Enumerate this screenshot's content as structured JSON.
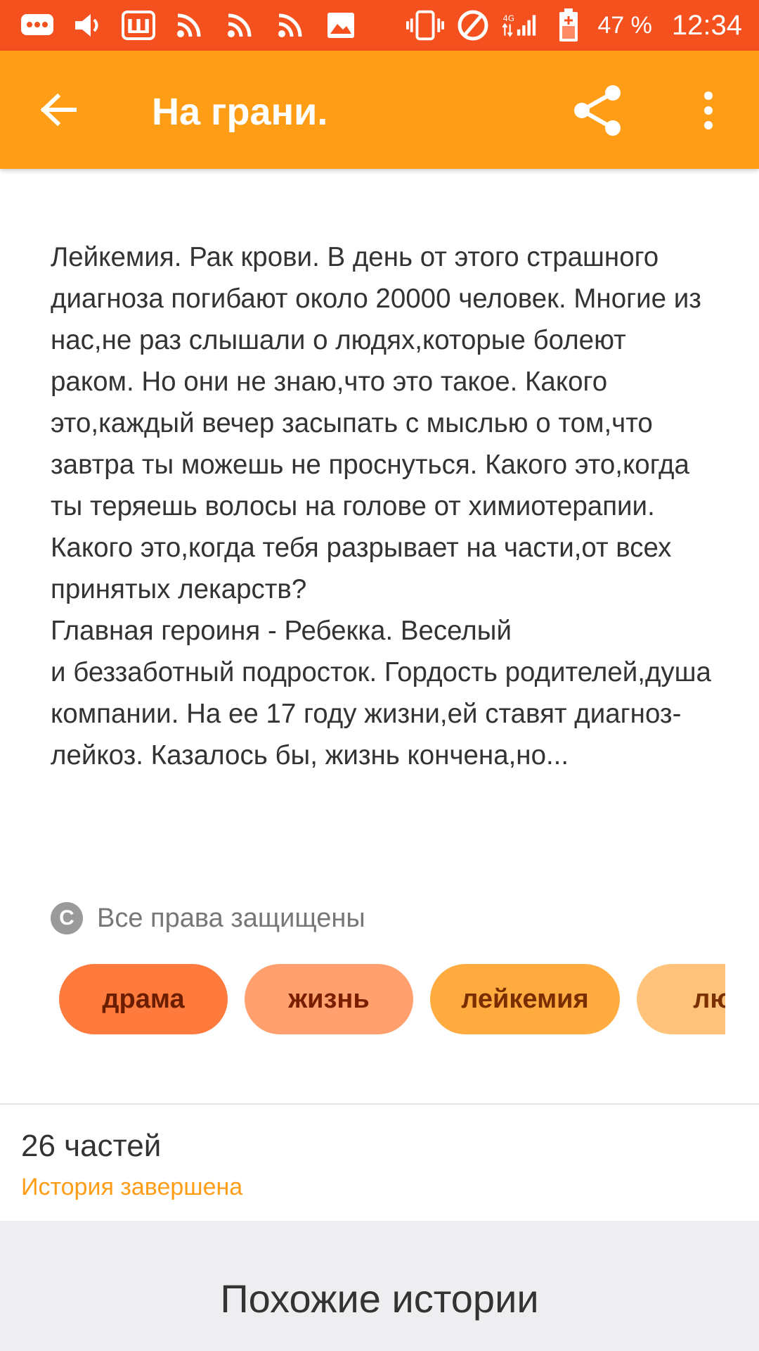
{
  "status_bar": {
    "battery_text": "47 %",
    "time": "12:34",
    "network": "4G",
    "icons": [
      "messages-icon",
      "volume-icon",
      "app-icon-sh",
      "rss-icon",
      "rss-icon",
      "rss-icon",
      "image-icon",
      "vibrate-icon",
      "do-not-disturb-icon",
      "signal-icon",
      "battery-icon"
    ],
    "color": "#f4511e"
  },
  "app_bar": {
    "title": "На грани.",
    "color": "#ff9d17",
    "back_icon": "arrow-left-icon",
    "share_icon": "share-icon",
    "more_icon": "more-vert-icon"
  },
  "description": {
    "paragraph1": "Лейкемия. Рак крови. В день от этого страшного диагноза погибают около 20000 человек. Многие из нас,не раз слышали о людях,которые болеют раком. Но они не знаю,что это такое. Какого это,каждый вечер засыпать с мыслью о том,что завтра ты можешь не проснуться. Какого это,когда ты теряешь волосы на голове от химиотерапии. Какого это,когда тебя разрывает на части,от всех принятых лекарств?",
    "paragraph2_line1": "Главная героиня - Ребекка. Веселый",
    "paragraph2_rest": "и беззаботный подросток. Гордость родителей,душа компании. На ее 17 году жизни,ей ставят диагноз-лейкоз. Казалось бы, жизнь кончена,но..."
  },
  "copyright": {
    "icon": "copyright-icon",
    "text": "Все права защищены"
  },
  "tags": [
    {
      "label": "драма",
      "bg": "#ff7a3d",
      "fg": "#6b1d00"
    },
    {
      "label": "жизнь",
      "bg": "#ffa06e",
      "fg": "#7a1e00"
    },
    {
      "label": "лейкемия",
      "bg": "#ffab40",
      "fg": "#7a2e00"
    },
    {
      "label": "люб",
      "bg": "#ffc27a",
      "fg": "#7a3000"
    }
  ],
  "story_info": {
    "parts": "26 частей",
    "status": "История завершена",
    "status_color": "#ff9d17"
  },
  "similar": {
    "title": "Похожие истории"
  }
}
